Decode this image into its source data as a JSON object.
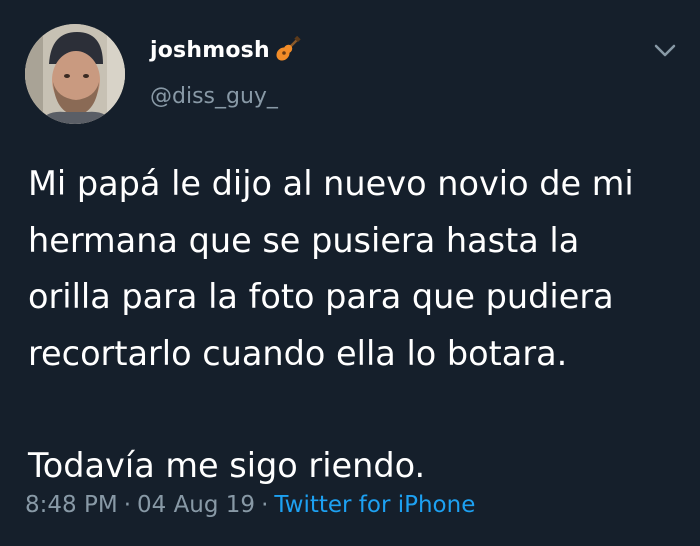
{
  "user": {
    "display_name": "joshmosh",
    "emoji_icon": "guitar-icon",
    "handle": "@diss_guy_"
  },
  "menu": {
    "icon": "chevron-down-icon"
  },
  "tweet": {
    "lines": [
      "Mi papá le dijo al nuevo novio de mi",
      "hermana que se pusiera hasta la",
      "orilla para la foto para que pudiera",
      "recortarlo cuando ella lo botara."
    ],
    "last_line": "Todavía me sigo riendo."
  },
  "meta": {
    "time": "8:48 PM",
    "separator": "·",
    "date": "04 Aug 19",
    "source": "Twitter for iPhone"
  },
  "colors": {
    "background": "#151f2b",
    "text": "#ffffff",
    "muted": "#8899a6",
    "link": "#1da1f2"
  }
}
